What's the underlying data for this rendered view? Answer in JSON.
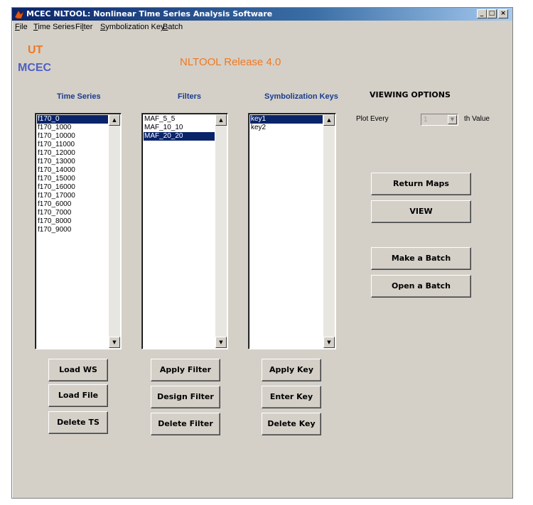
{
  "window": {
    "title": "MCEC NLTOOL: Nonlinear Time Series Analysis Software",
    "controls": [
      "_",
      "□",
      "×"
    ]
  },
  "menu": [
    {
      "pre": "",
      "mn": "F",
      "post": "ile"
    },
    {
      "pre": "",
      "mn": "T",
      "post": "ime Series"
    },
    {
      "pre": "Fi",
      "mn": "l",
      "post": "ter"
    },
    {
      "pre": "",
      "mn": "S",
      "post": "ymbolization Key"
    },
    {
      "pre": "",
      "mn": "B",
      "post": "atch"
    }
  ],
  "logo": {
    "ut": "UT",
    "mcec": "MCEC",
    "ut_color": "#f07820",
    "mcec_color": "#5060c0"
  },
  "release": "NLTOOL Release 4.0",
  "columns": {
    "time_series": {
      "header": "Time Series",
      "items": [
        "f170_0",
        "f170_1000",
        "f170_10000",
        "f170_11000",
        "f170_12000",
        "f170_13000",
        "f170_14000",
        "f170_15000",
        "f170_16000",
        "f170_17000",
        "f170_6000",
        "f170_7000",
        "f170_8000",
        "f170_9000"
      ],
      "selected": 0
    },
    "filters": {
      "header": "Filters",
      "items": [
        "MAF_5_5",
        "MAF_10_10",
        "MAF_20_20"
      ],
      "selected": 2
    },
    "keys": {
      "header": "Symbolization Keys",
      "items": [
        "key1",
        "key2"
      ],
      "selected": 0
    }
  },
  "buttons": {
    "load_ws": "Load WS",
    "load_file": "Load File",
    "delete_ts": "Delete TS",
    "apply_filter": "Apply Filter",
    "design_filter": "Design Filter",
    "delete_filter": "Delete Filter",
    "apply_key": "Apply Key",
    "enter_key": "Enter Key",
    "delete_key": "Delete Key",
    "return_maps": "Return Maps",
    "view": "VIEW",
    "make_batch": "Make a Batch",
    "open_batch": "Open a Batch"
  },
  "viewing": {
    "title": "VIEWING OPTIONS",
    "plot_every": "Plot Every",
    "value": "1",
    "suffix": "th Value"
  },
  "icons": {
    "scroll_up": "▲",
    "scroll_down": "▼",
    "dropdown": "▼"
  },
  "colors": {
    "selection": "#0a246a",
    "header_text": "#1a3c8c",
    "release_text": "#f07820"
  }
}
